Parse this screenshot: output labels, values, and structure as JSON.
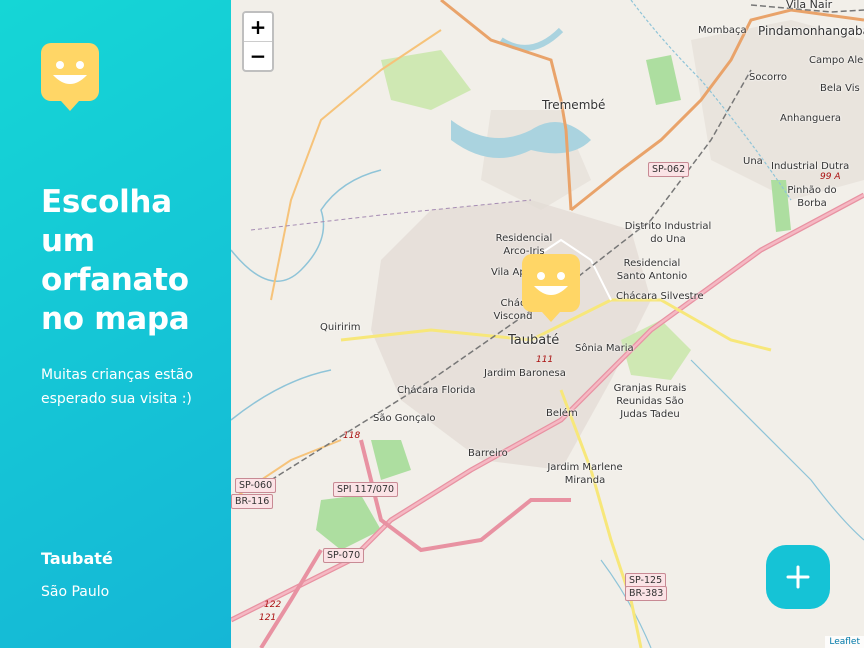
{
  "sidebar": {
    "title": "Escolha um orfanato no mapa",
    "subtitle": "Muitas crianças estão esperado sua visita :)",
    "city": "Taubaté",
    "state": "São Paulo"
  },
  "map": {
    "zoom_in_label": "+",
    "zoom_out_label": "−",
    "attribution": "Leaflet",
    "labels": {
      "vila_nair": "Vila Nair",
      "mombaca": "Mombaça",
      "pindamonhangaba": "Pindamonhangaba",
      "campo_alegre": "Campo Ale",
      "bela_vista": "Bela Vis",
      "socorro": "Socorro",
      "anhanguera": "Anhanguera",
      "tremembe": "Tremembé",
      "una": "Una",
      "industrial_dutra": "Industrial Dutra",
      "pinhao_do_borba": "Pinhão do Borba",
      "distrito_industrial": "Distrito Industrial do Una",
      "residencial_arco_iris": "Residencial Arco-Iris",
      "residencial_santo_antonio": "Residencial Santo Antonio",
      "vila_aparecida": "Vila Ap",
      "chacara_silvestre": "Chácara Silvestre",
      "chacara_visconde": "Chác Viscond",
      "quiririm": "Quiririm",
      "taubate": "Taubaté",
      "sonia_maria": "Sônia Maria",
      "jardim_baronesa": "Jardim Baronesa",
      "chacara_florida": "Chácara Florida",
      "granjas_rurais": "Granjas Rurais Reunidas São Judas Tadeu",
      "sao_goncalo": "São Gonçalo",
      "belem": "Belém",
      "barreiro": "Barreiro",
      "jardim_marlene": "Jardim Marlene Miranda"
    },
    "shields": {
      "sp062": "SP-062",
      "sp060": "SP-060",
      "br116": "BR-116",
      "spi117": "SPI 117/070",
      "sp070": "SP-070",
      "sp125": "SP-125",
      "br383": "BR-383"
    },
    "road_numbers": {
      "r111": "111",
      "r118": "118",
      "r99a": "99 A",
      "r122": "122",
      "r121": "121"
    }
  },
  "colors": {
    "sidebar_gradient_start": "#15b6d6",
    "sidebar_gradient_end": "#15d6d6",
    "marker_yellow": "#ffd666",
    "add_button": "#15c3d6"
  },
  "icons": {
    "logo": "smiley-marker-icon",
    "marker": "smiley-marker-icon",
    "add": "plus-icon"
  }
}
